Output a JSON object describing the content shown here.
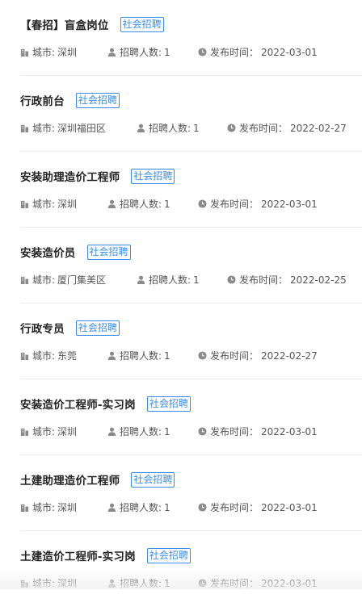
{
  "labels": {
    "city": "城市:",
    "count": "招聘人数:",
    "date": "发布时间："
  },
  "colors": {
    "tag_blue": "#3a8ee6",
    "icon_gray": "#8a8a8a",
    "divider": "#ececec"
  },
  "icons": {
    "city": "building-icon",
    "count": "person-icon",
    "date": "clock-icon"
  },
  "jobs": [
    {
      "title": "【春招】盲盒岗位",
      "tag": "社会招聘",
      "city": "深圳",
      "count": "1",
      "date": "2022-03-01"
    },
    {
      "title": "行政前台",
      "tag": "社会招聘",
      "city": "深圳福田区",
      "count": "1",
      "date": "2022-02-27"
    },
    {
      "title": "安装助理造价工程师",
      "tag": "社会招聘",
      "city": "深圳",
      "count": "1",
      "date": "2022-03-01"
    },
    {
      "title": "安装造价员",
      "tag": "社会招聘",
      "city": "厦门集美区",
      "count": "1",
      "date": "2022-02-25"
    },
    {
      "title": "行政专员",
      "tag": "社会招聘",
      "city": "东莞",
      "count": "1",
      "date": "2022-02-27"
    },
    {
      "title": "安装造价工程师-实习岗",
      "tag": "社会招聘",
      "city": "深圳",
      "count": "1",
      "date": "2022-03-01"
    },
    {
      "title": "土建助理造价工程师",
      "tag": "社会招聘",
      "city": "深圳",
      "count": "1",
      "date": "2022-03-01"
    },
    {
      "title": "土建造价工程师-实习岗",
      "tag": "社会招聘",
      "city": "深圳",
      "count": "1",
      "date": "2022-03-01"
    }
  ]
}
